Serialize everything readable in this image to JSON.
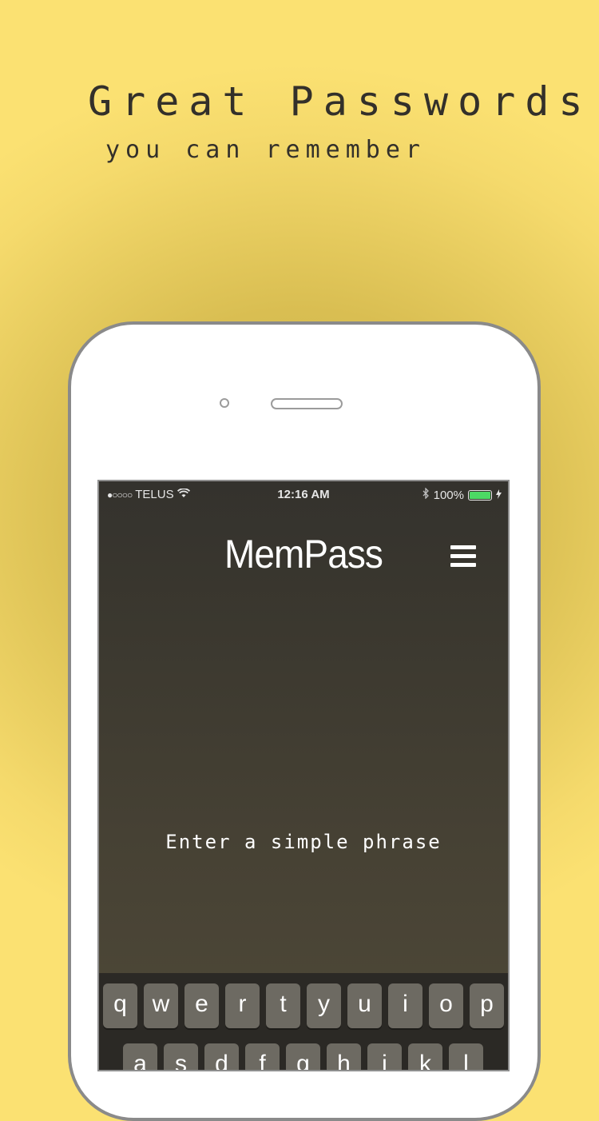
{
  "promo": {
    "headline": "Great Passwords",
    "subline": "you can remember",
    "background_color": "#d9be52"
  },
  "status_bar": {
    "carrier": "TELUS",
    "signal_dots": "●○○○○",
    "time": "12:16 AM",
    "battery_percent": "100%",
    "battery_level": 1.0,
    "battery_color": "#4cd964",
    "icons": [
      "wifi-icon",
      "bluetooth-icon",
      "charging-bolt-icon"
    ]
  },
  "app": {
    "title": "MemPass",
    "menu_icon": "hamburger-menu-icon",
    "prompt": "Enter a simple phrase"
  },
  "keyboard": {
    "row1": [
      "q",
      "w",
      "e",
      "r",
      "t",
      "y",
      "u",
      "i",
      "o",
      "p"
    ],
    "row2": [
      "a",
      "s",
      "d",
      "f",
      "g",
      "h",
      "j",
      "k",
      "l"
    ]
  }
}
